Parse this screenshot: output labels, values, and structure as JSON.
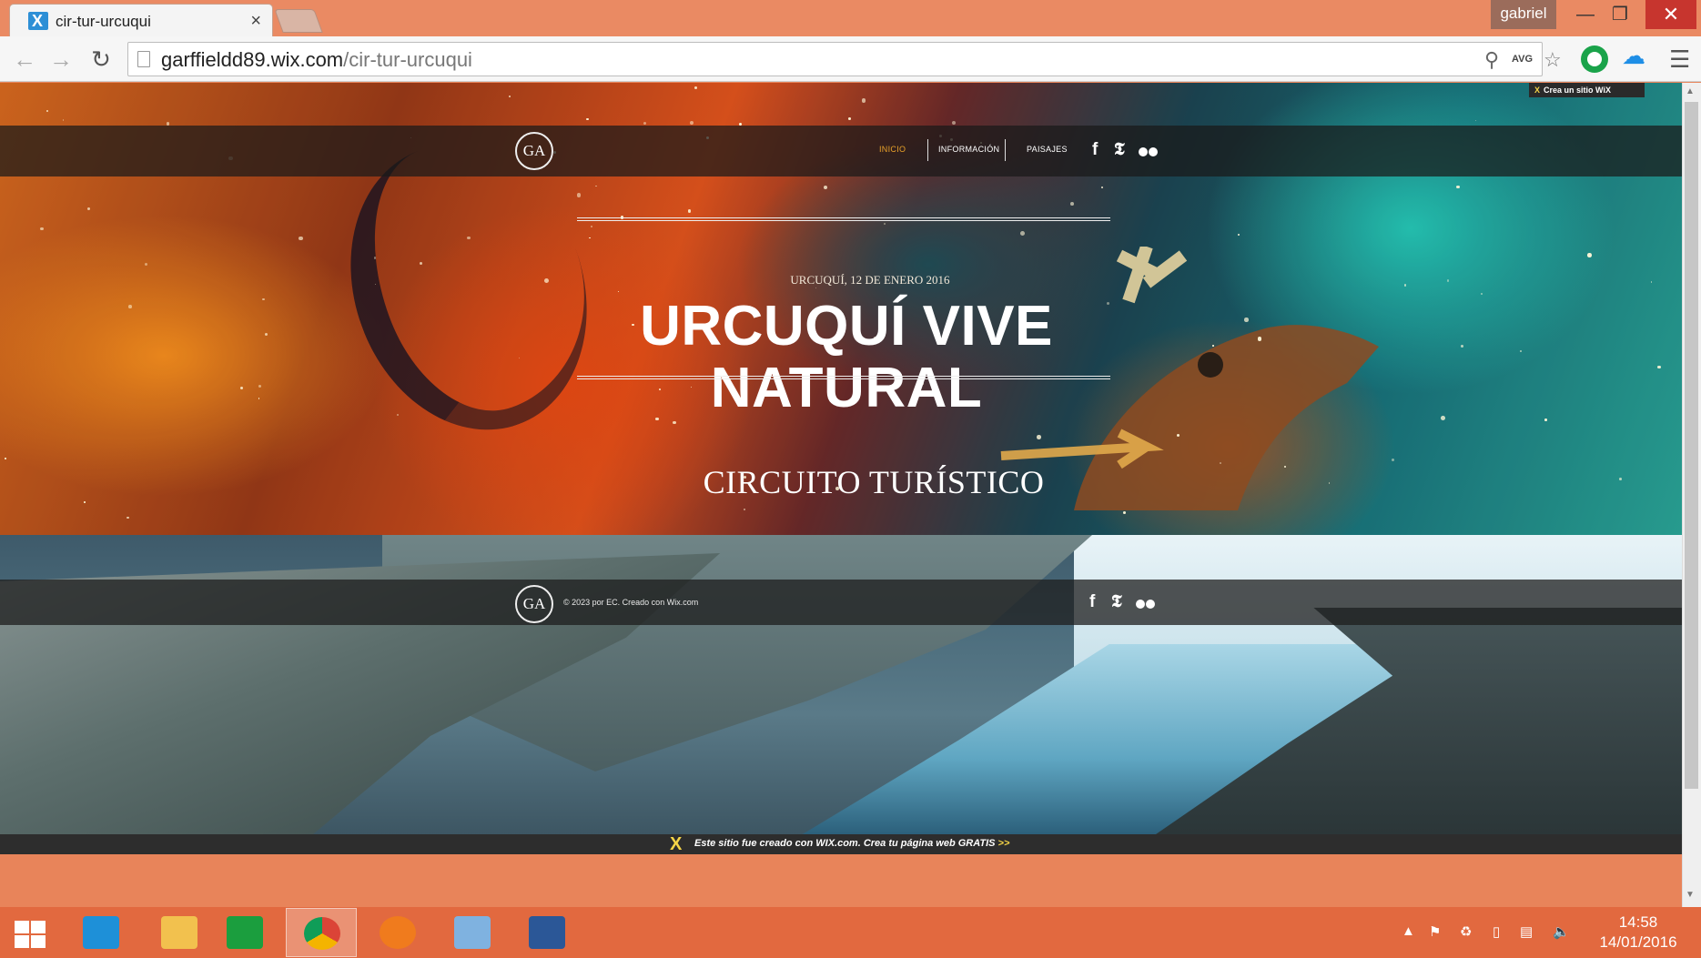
{
  "browser": {
    "tab_title": "cir-tur-urcuqui",
    "tab_close": "×",
    "user_name": "gabriel",
    "url_host": "garffieldd89.wix.com",
    "url_path": "/cir-tur-urcuqui",
    "avg_label": "AVG",
    "window_min": "—",
    "window_max": "❐",
    "window_close": "✕"
  },
  "site": {
    "crea_badge": "Crea un sitio WiX",
    "logo_text": "GA",
    "nav": [
      {
        "label": "INICIO",
        "active": true
      },
      {
        "label": "INFORMACIÓN",
        "active": false
      },
      {
        "label": "PAISAJES",
        "active": false
      }
    ],
    "social": {
      "facebook": "f",
      "twitter": "t"
    },
    "hero": {
      "date": "URCUQUÍ, 12 DE ENERO 2016",
      "title_line1": "URCUQUÍ VIVE",
      "title_line2": "NATURAL",
      "subtitle": "CIRCUITO TURÍSTICO"
    },
    "footer": {
      "copyright": "© 2023 por EC. Creado con Wix.com"
    },
    "wix_banner": {
      "text": "Este sitio fue creado con WIX.com. Crea tu página web GRATIS",
      "arrow": ">>"
    }
  },
  "taskbar": {
    "apps": [
      {
        "name": "internet-explorer",
        "color": "#1e90d8"
      },
      {
        "name": "file-explorer",
        "color": "#f2c14e"
      },
      {
        "name": "windows-store",
        "color": "#1b9e3e"
      },
      {
        "name": "google-chrome",
        "color": "#ffffff"
      },
      {
        "name": "firefox",
        "color": "#f07b1d"
      },
      {
        "name": "remote-desktop",
        "color": "#7fb2e0"
      },
      {
        "name": "microsoft-word",
        "color": "#2b5797"
      }
    ],
    "time": "14:58",
    "date": "14/01/2016"
  }
}
